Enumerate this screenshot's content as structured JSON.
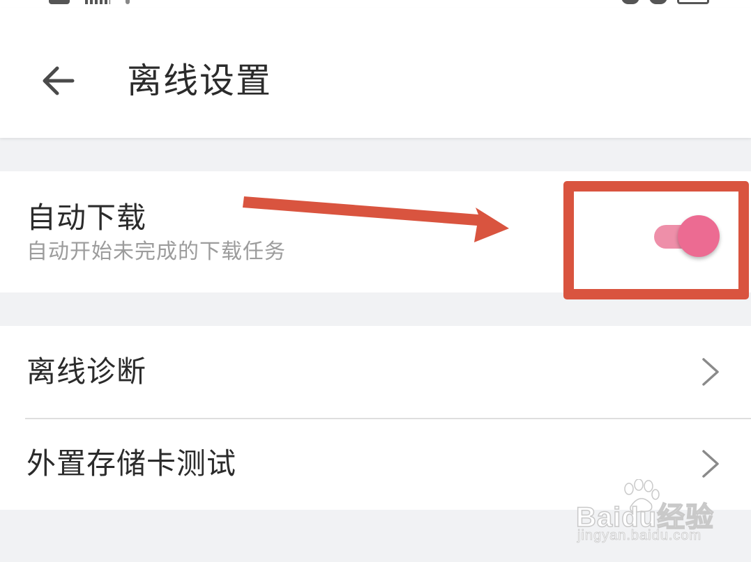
{
  "header": {
    "title": "离线设置",
    "back_icon": "arrow-left-icon"
  },
  "auto_download": {
    "title": "自动下载",
    "subtitle": "自动开始未完成的下载任务",
    "toggle_on": true,
    "toggle_track_color": "#ee8fa9",
    "toggle_thumb_color": "#ec6b92"
  },
  "list": {
    "items": [
      {
        "label": "离线诊断",
        "icon": "chevron-right-icon"
      },
      {
        "label": "外置存储卡测试",
        "icon": "chevron-right-icon"
      }
    ]
  },
  "annotation": {
    "color": "#d9543f"
  },
  "watermark": {
    "brand": "Baidu经验",
    "url": "jingyan.baidu.com"
  },
  "colors": {
    "background": "#f1f2f4",
    "surface": "#ffffff",
    "text_primary": "#2b2b2b",
    "text_secondary": "#9c9c9c"
  }
}
